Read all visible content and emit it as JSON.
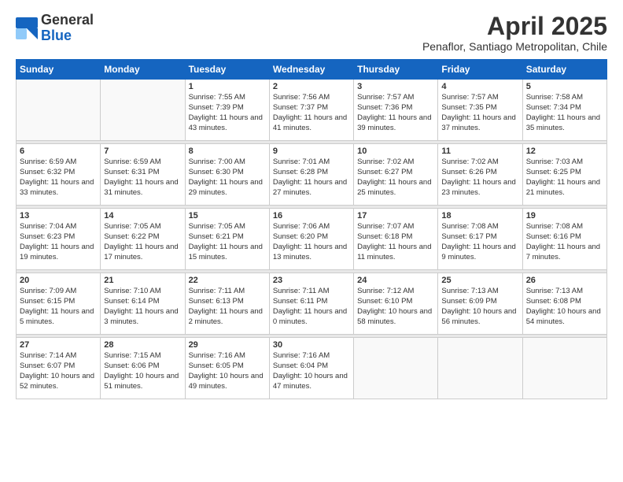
{
  "logo": {
    "general": "General",
    "blue": "Blue"
  },
  "title": "April 2025",
  "subtitle": "Penaflor, Santiago Metropolitan, Chile",
  "header_days": [
    "Sunday",
    "Monday",
    "Tuesday",
    "Wednesday",
    "Thursday",
    "Friday",
    "Saturday"
  ],
  "weeks": [
    [
      {
        "day": "",
        "info": ""
      },
      {
        "day": "",
        "info": ""
      },
      {
        "day": "1",
        "info": "Sunrise: 7:55 AM\nSunset: 7:39 PM\nDaylight: 11 hours\nand 43 minutes."
      },
      {
        "day": "2",
        "info": "Sunrise: 7:56 AM\nSunset: 7:37 PM\nDaylight: 11 hours\nand 41 minutes."
      },
      {
        "day": "3",
        "info": "Sunrise: 7:57 AM\nSunset: 7:36 PM\nDaylight: 11 hours\nand 39 minutes."
      },
      {
        "day": "4",
        "info": "Sunrise: 7:57 AM\nSunset: 7:35 PM\nDaylight: 11 hours\nand 37 minutes."
      },
      {
        "day": "5",
        "info": "Sunrise: 7:58 AM\nSunset: 7:34 PM\nDaylight: 11 hours\nand 35 minutes."
      }
    ],
    [
      {
        "day": "6",
        "info": "Sunrise: 6:59 AM\nSunset: 6:32 PM\nDaylight: 11 hours\nand 33 minutes."
      },
      {
        "day": "7",
        "info": "Sunrise: 6:59 AM\nSunset: 6:31 PM\nDaylight: 11 hours\nand 31 minutes."
      },
      {
        "day": "8",
        "info": "Sunrise: 7:00 AM\nSunset: 6:30 PM\nDaylight: 11 hours\nand 29 minutes."
      },
      {
        "day": "9",
        "info": "Sunrise: 7:01 AM\nSunset: 6:28 PM\nDaylight: 11 hours\nand 27 minutes."
      },
      {
        "day": "10",
        "info": "Sunrise: 7:02 AM\nSunset: 6:27 PM\nDaylight: 11 hours\nand 25 minutes."
      },
      {
        "day": "11",
        "info": "Sunrise: 7:02 AM\nSunset: 6:26 PM\nDaylight: 11 hours\nand 23 minutes."
      },
      {
        "day": "12",
        "info": "Sunrise: 7:03 AM\nSunset: 6:25 PM\nDaylight: 11 hours\nand 21 minutes."
      }
    ],
    [
      {
        "day": "13",
        "info": "Sunrise: 7:04 AM\nSunset: 6:23 PM\nDaylight: 11 hours\nand 19 minutes."
      },
      {
        "day": "14",
        "info": "Sunrise: 7:05 AM\nSunset: 6:22 PM\nDaylight: 11 hours\nand 17 minutes."
      },
      {
        "day": "15",
        "info": "Sunrise: 7:05 AM\nSunset: 6:21 PM\nDaylight: 11 hours\nand 15 minutes."
      },
      {
        "day": "16",
        "info": "Sunrise: 7:06 AM\nSunset: 6:20 PM\nDaylight: 11 hours\nand 13 minutes."
      },
      {
        "day": "17",
        "info": "Sunrise: 7:07 AM\nSunset: 6:18 PM\nDaylight: 11 hours\nand 11 minutes."
      },
      {
        "day": "18",
        "info": "Sunrise: 7:08 AM\nSunset: 6:17 PM\nDaylight: 11 hours\nand 9 minutes."
      },
      {
        "day": "19",
        "info": "Sunrise: 7:08 AM\nSunset: 6:16 PM\nDaylight: 11 hours\nand 7 minutes."
      }
    ],
    [
      {
        "day": "20",
        "info": "Sunrise: 7:09 AM\nSunset: 6:15 PM\nDaylight: 11 hours\nand 5 minutes."
      },
      {
        "day": "21",
        "info": "Sunrise: 7:10 AM\nSunset: 6:14 PM\nDaylight: 11 hours\nand 3 minutes."
      },
      {
        "day": "22",
        "info": "Sunrise: 7:11 AM\nSunset: 6:13 PM\nDaylight: 11 hours\nand 2 minutes."
      },
      {
        "day": "23",
        "info": "Sunrise: 7:11 AM\nSunset: 6:11 PM\nDaylight: 11 hours\nand 0 minutes."
      },
      {
        "day": "24",
        "info": "Sunrise: 7:12 AM\nSunset: 6:10 PM\nDaylight: 10 hours\nand 58 minutes."
      },
      {
        "day": "25",
        "info": "Sunrise: 7:13 AM\nSunset: 6:09 PM\nDaylight: 10 hours\nand 56 minutes."
      },
      {
        "day": "26",
        "info": "Sunrise: 7:13 AM\nSunset: 6:08 PM\nDaylight: 10 hours\nand 54 minutes."
      }
    ],
    [
      {
        "day": "27",
        "info": "Sunrise: 7:14 AM\nSunset: 6:07 PM\nDaylight: 10 hours\nand 52 minutes."
      },
      {
        "day": "28",
        "info": "Sunrise: 7:15 AM\nSunset: 6:06 PM\nDaylight: 10 hours\nand 51 minutes."
      },
      {
        "day": "29",
        "info": "Sunrise: 7:16 AM\nSunset: 6:05 PM\nDaylight: 10 hours\nand 49 minutes."
      },
      {
        "day": "30",
        "info": "Sunrise: 7:16 AM\nSunset: 6:04 PM\nDaylight: 10 hours\nand 47 minutes."
      },
      {
        "day": "",
        "info": ""
      },
      {
        "day": "",
        "info": ""
      },
      {
        "day": "",
        "info": ""
      }
    ]
  ]
}
